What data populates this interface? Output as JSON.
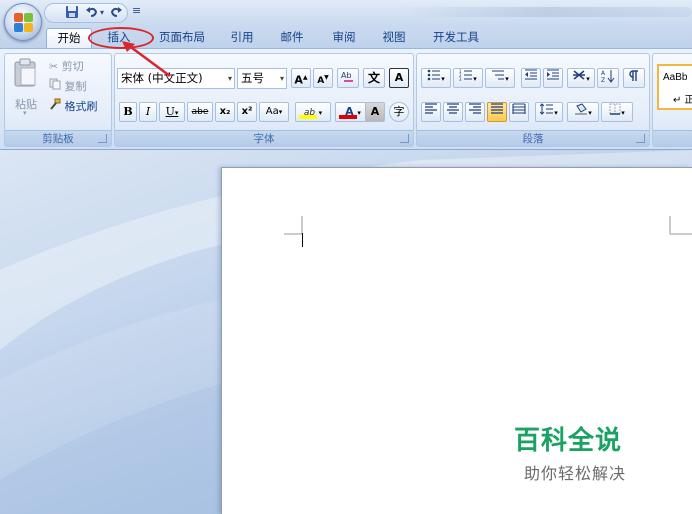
{
  "quick_access": {
    "customize_label": "≡"
  },
  "tabs": [
    {
      "label": "开始"
    },
    {
      "label": "插入"
    },
    {
      "label": "页面布局"
    },
    {
      "label": "引用"
    },
    {
      "label": "邮件"
    },
    {
      "label": "审阅"
    },
    {
      "label": "视图"
    },
    {
      "label": "开发工具"
    }
  ],
  "clipboard": {
    "paste_label": "粘贴",
    "cut_label": "剪切",
    "copy_label": "复制",
    "format_painter_label": "格式刷",
    "group_label": "剪贴板"
  },
  "font": {
    "font_name": "宋体 (中文正文)",
    "font_size": "五号",
    "grow_label": "A",
    "shrink_label": "A",
    "phonetic_label": "文",
    "border_label": "A",
    "bold_label": "B",
    "italic_label": "I",
    "underline_label": "U",
    "strike_label": "abe",
    "subscript_label": "x₂",
    "superscript_label": "x²",
    "case_label": "Aa",
    "highlight_label": "ab",
    "color_label": "A",
    "shading_label": "A",
    "enclose_label": "字",
    "group_label": "字体",
    "highlight_color": "#ffff00",
    "font_color": "#e00000"
  },
  "paragraph": {
    "group_label": "段落"
  },
  "styles": {
    "preview_text": "AaBb",
    "preview_sub": "↵ 正"
  },
  "watermark": {
    "title": "百科全说",
    "subtitle": "助你轻松解决"
  },
  "colors": {
    "annotation_red": "#d9262c",
    "watermark_green": "#1aa262"
  }
}
